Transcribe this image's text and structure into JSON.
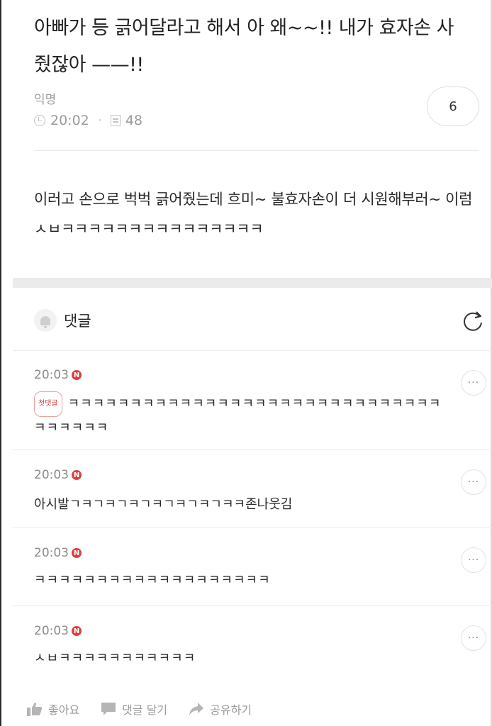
{
  "post": {
    "title": "아빠가 등 긁어달라고 해서 아 왜~~!! 내가 효자손 사줬잖아 ——!!",
    "author": "익명",
    "time": "20:02",
    "views": "48",
    "comment_count": "6",
    "body": "이러고 손으로 벅벅 긁어줬는데 흐미~ 불효자손이 더 시원해부러~ 이럼 ㅅㅂㅋㅋㅋㅋㅋㅋㅋㅋㅋㅋㅋㅋㅋㅋㅋ"
  },
  "comments_section": {
    "label": "댓글"
  },
  "comments": [
    {
      "time": "20:03",
      "badge": "N",
      "tag": "첫댓글",
      "text": "ㅋㅋㅋㅋㅋㅋㅋㅋㅋㅋㅋㅋㅋㅋㅋㅋㅋㅋㅋㅋㅋㅋㅋㅋㅋㅋㅋㅋㅋㅋㅋㅋㅋㅋㅋㅋ"
    },
    {
      "time": "20:03",
      "badge": "N",
      "text": "아시발ㄱㅋㄱㅋㄱㅋㄱㅋㄱㅋㄱㅋㄱㅋㅋ존나웃김"
    },
    {
      "time": "20:03",
      "badge": "N",
      "text": "ㅋㅋㅋㅋㅋㅋㅋㅋㅋㅋㅋㅋㅋㅋㅋㅋㅋㅋㅋ"
    },
    {
      "time": "20:03",
      "badge": "N",
      "text": "ㅅㅂㅋㅋㅋㅋㅋㅋㅋㅋㅋㅋㅋ"
    }
  ],
  "more_label": "···",
  "footer": {
    "like": "좋아요",
    "comment": "댓글 달기",
    "share": "공유하기"
  }
}
